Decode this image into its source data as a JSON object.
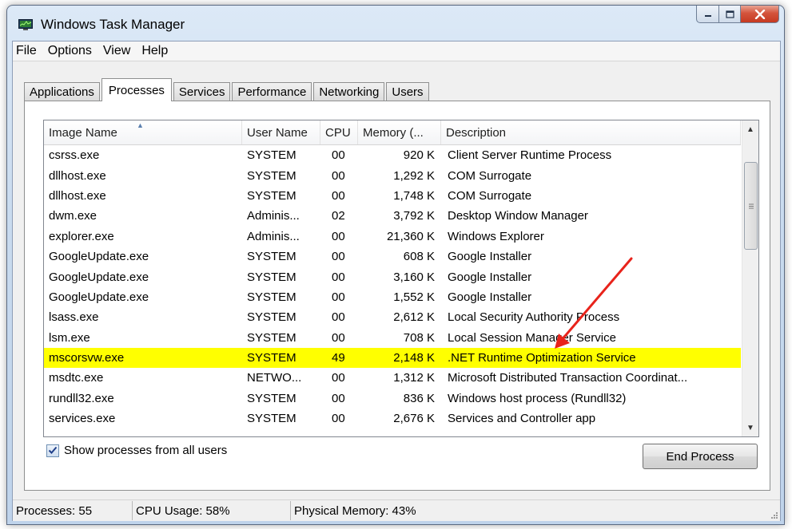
{
  "window": {
    "title": "Windows Task Manager"
  },
  "menu": [
    "File",
    "Options",
    "View",
    "Help"
  ],
  "tabs": [
    "Applications",
    "Processes",
    "Services",
    "Performance",
    "Networking",
    "Users"
  ],
  "active_tab": "Processes",
  "columns": [
    "Image Name",
    "User Name",
    "CPU",
    "Memory (...",
    "Description"
  ],
  "rows": [
    {
      "name": "csrss.exe",
      "user": "SYSTEM",
      "cpu": "00",
      "mem": "920 K",
      "desc": "Client Server Runtime Process"
    },
    {
      "name": "dllhost.exe",
      "user": "SYSTEM",
      "cpu": "00",
      "mem": "1,292 K",
      "desc": "COM Surrogate"
    },
    {
      "name": "dllhost.exe",
      "user": "SYSTEM",
      "cpu": "00",
      "mem": "1,748 K",
      "desc": "COM Surrogate"
    },
    {
      "name": "dwm.exe",
      "user": "Adminis...",
      "cpu": "02",
      "mem": "3,792 K",
      "desc": "Desktop Window Manager"
    },
    {
      "name": "explorer.exe",
      "user": "Adminis...",
      "cpu": "00",
      "mem": "21,360 K",
      "desc": "Windows Explorer"
    },
    {
      "name": "GoogleUpdate.exe",
      "user": "SYSTEM",
      "cpu": "00",
      "mem": "608 K",
      "desc": "Google Installer"
    },
    {
      "name": "GoogleUpdate.exe",
      "user": "SYSTEM",
      "cpu": "00",
      "mem": "3,160 K",
      "desc": "Google Installer"
    },
    {
      "name": "GoogleUpdate.exe",
      "user": "SYSTEM",
      "cpu": "00",
      "mem": "1,552 K",
      "desc": "Google Installer"
    },
    {
      "name": "lsass.exe",
      "user": "SYSTEM",
      "cpu": "00",
      "mem": "2,612 K",
      "desc": "Local Security Authority Process"
    },
    {
      "name": "lsm.exe",
      "user": "SYSTEM",
      "cpu": "00",
      "mem": "708 K",
      "desc": "Local Session Manager Service"
    },
    {
      "name": "mscorsvw.exe",
      "user": "SYSTEM",
      "cpu": "49",
      "mem": "2,148 K",
      "desc": ".NET Runtime Optimization Service",
      "highlight": true
    },
    {
      "name": "msdtc.exe",
      "user": "NETWO...",
      "cpu": "00",
      "mem": "1,312 K",
      "desc": "Microsoft Distributed Transaction Coordinat..."
    },
    {
      "name": "rundll32.exe",
      "user": "SYSTEM",
      "cpu": "00",
      "mem": "836 K",
      "desc": "Windows host process (Rundll32)"
    },
    {
      "name": "services.exe",
      "user": "SYSTEM",
      "cpu": "00",
      "mem": "2,676 K",
      "desc": "Services and Controller app"
    }
  ],
  "show_all_users": {
    "label": "Show processes from all users",
    "checked": true
  },
  "end_process_label": "End Process",
  "status": {
    "processes": "Processes: 55",
    "cpu": "CPU Usage: 58%",
    "memory": "Physical Memory: 43%"
  },
  "colors": {
    "highlight": "#ffff00",
    "annotation_arrow": "#e8231b"
  }
}
